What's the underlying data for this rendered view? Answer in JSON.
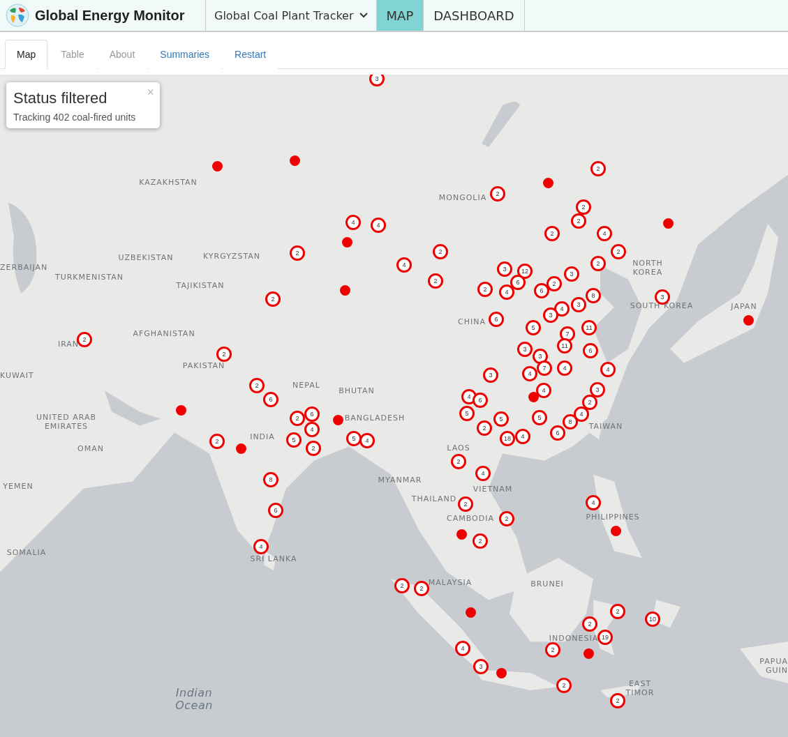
{
  "header": {
    "brand": "Global Energy Monitor",
    "tracker": "Global Coal Plant Tracker",
    "nav": [
      {
        "label": "MAP",
        "selected": true
      },
      {
        "label": "DASHBOARD",
        "selected": false
      }
    ]
  },
  "tabs": [
    {
      "label": "Map",
      "selected": true,
      "kind": "tab",
      "disabled": false
    },
    {
      "label": "Table",
      "selected": false,
      "kind": "tab",
      "disabled": true
    },
    {
      "label": "About",
      "selected": false,
      "kind": "tab",
      "disabled": true
    },
    {
      "label": "Summaries",
      "selected": false,
      "kind": "link",
      "disabled": false
    },
    {
      "label": "Restart",
      "selected": false,
      "kind": "link",
      "disabled": false
    }
  ],
  "info": {
    "title": "Status filtered",
    "text": "Tracking 402 coal-fired units",
    "close": "×"
  },
  "map": {
    "labels": [
      "KAZAKHSTAN",
      "MONGOLIA",
      "UZBEKISTAN",
      "KYRGYZSTAN",
      "ZERBAIJAN",
      "NORTH KOREA",
      "TURKMENISTAN",
      "TAJIKISTAN",
      "SOUTH KOREA",
      "JAPAN",
      "CHINA",
      "AFGHANISTAN",
      "IRAN",
      "PAKISTAN",
      "KUWAIT",
      "NEPAL",
      "BHUTAN",
      "UNITED ARAB EMIRATES",
      "BANGLADESH",
      "TAIWAN",
      "INDIA",
      "OMAN",
      "LAOS",
      "MYANMAR",
      "YEMEN",
      "VIETNAM",
      "THAILAND",
      "CAMBODIA",
      "PHILIPPINES",
      "SOMALIA",
      "SRI LANKA",
      "MALAYSIA",
      "BRUNEI",
      "INDONESIA",
      "PAPUA GUIN",
      "EAST TIMOR",
      "Indian Ocean"
    ],
    "markers": [
      {
        "kind": "cluster",
        "count": "3"
      },
      {
        "kind": "plant"
      },
      {
        "kind": "plant"
      },
      {
        "kind": "cluster",
        "count": "2"
      },
      {
        "kind": "plant"
      },
      {
        "kind": "cluster",
        "count": "2"
      },
      {
        "kind": "cluster",
        "count": "2"
      },
      {
        "kind": "cluster",
        "count": "4"
      },
      {
        "kind": "cluster",
        "count": "4"
      },
      {
        "kind": "cluster",
        "count": "2"
      },
      {
        "kind": "plant"
      },
      {
        "kind": "cluster",
        "count": "2"
      },
      {
        "kind": "cluster",
        "count": "4"
      },
      {
        "kind": "plant"
      },
      {
        "kind": "cluster",
        "count": "2"
      },
      {
        "kind": "cluster",
        "count": "2"
      },
      {
        "kind": "cluster",
        "count": "2"
      },
      {
        "kind": "cluster",
        "count": "4"
      },
      {
        "kind": "cluster",
        "count": "2"
      },
      {
        "kind": "cluster",
        "count": "3"
      },
      {
        "kind": "cluster",
        "count": "12"
      },
      {
        "kind": "cluster",
        "count": "3"
      },
      {
        "kind": "cluster",
        "count": "2"
      },
      {
        "kind": "cluster",
        "count": "6"
      },
      {
        "kind": "cluster",
        "count": "2"
      },
      {
        "kind": "plant"
      },
      {
        "kind": "cluster",
        "count": "2"
      },
      {
        "kind": "cluster",
        "count": "4"
      },
      {
        "kind": "cluster",
        "count": "6"
      },
      {
        "kind": "cluster",
        "count": "2"
      },
      {
        "kind": "cluster",
        "count": "8"
      },
      {
        "kind": "cluster",
        "count": "3"
      },
      {
        "kind": "cluster",
        "count": "3"
      },
      {
        "kind": "cluster",
        "count": "4"
      },
      {
        "kind": "cluster",
        "count": "3"
      },
      {
        "kind": "cluster",
        "count": "6"
      },
      {
        "kind": "plant"
      },
      {
        "kind": "cluster",
        "count": "5"
      },
      {
        "kind": "cluster",
        "count": "11"
      },
      {
        "kind": "cluster",
        "count": "7"
      },
      {
        "kind": "cluster",
        "count": "2"
      },
      {
        "kind": "cluster",
        "count": "11"
      },
      {
        "kind": "cluster",
        "count": "2"
      },
      {
        "kind": "cluster",
        "count": "3"
      },
      {
        "kind": "cluster",
        "count": "3"
      },
      {
        "kind": "cluster",
        "count": "6"
      },
      {
        "kind": "cluster",
        "count": "3"
      },
      {
        "kind": "cluster",
        "count": "4"
      },
      {
        "kind": "cluster",
        "count": "7"
      },
      {
        "kind": "cluster",
        "count": "4"
      },
      {
        "kind": "cluster",
        "count": "4"
      },
      {
        "kind": "cluster",
        "count": "2"
      },
      {
        "kind": "cluster",
        "count": "4"
      },
      {
        "kind": "cluster",
        "count": "3"
      },
      {
        "kind": "cluster",
        "count": "6"
      },
      {
        "kind": "cluster",
        "count": "4"
      },
      {
        "kind": "cluster",
        "count": "6"
      },
      {
        "kind": "plant"
      },
      {
        "kind": "cluster",
        "count": "2"
      },
      {
        "kind": "plant"
      },
      {
        "kind": "cluster",
        "count": "2"
      },
      {
        "kind": "cluster",
        "count": "6"
      },
      {
        "kind": "plant"
      },
      {
        "kind": "cluster",
        "count": "5"
      },
      {
        "kind": "cluster",
        "count": "5"
      },
      {
        "kind": "cluster",
        "count": "5"
      },
      {
        "kind": "cluster",
        "count": "8"
      },
      {
        "kind": "cluster",
        "count": "4"
      },
      {
        "kind": "cluster",
        "count": "4"
      },
      {
        "kind": "cluster",
        "count": "2"
      },
      {
        "kind": "cluster",
        "count": "2"
      },
      {
        "kind": "cluster",
        "count": "5"
      },
      {
        "kind": "cluster",
        "count": "5"
      },
      {
        "kind": "cluster",
        "count": "4"
      },
      {
        "kind": "cluster",
        "count": "18"
      },
      {
        "kind": "cluster",
        "count": "4"
      },
      {
        "kind": "cluster",
        "count": "6"
      },
      {
        "kind": "plant"
      },
      {
        "kind": "cluster",
        "count": "2"
      },
      {
        "kind": "cluster",
        "count": "2"
      },
      {
        "kind": "cluster",
        "count": "4"
      },
      {
        "kind": "cluster",
        "count": "8"
      },
      {
        "kind": "cluster",
        "count": "2"
      },
      {
        "kind": "cluster",
        "count": "4"
      },
      {
        "kind": "cluster",
        "count": "6"
      },
      {
        "kind": "cluster",
        "count": "2"
      },
      {
        "kind": "plant"
      },
      {
        "kind": "plant"
      },
      {
        "kind": "cluster",
        "count": "2"
      },
      {
        "kind": "cluster",
        "count": "4"
      },
      {
        "kind": "cluster",
        "count": "2"
      },
      {
        "kind": "cluster",
        "count": "2"
      },
      {
        "kind": "plant"
      },
      {
        "kind": "cluster",
        "count": "2"
      },
      {
        "kind": "cluster",
        "count": "10"
      },
      {
        "kind": "cluster",
        "count": "2"
      },
      {
        "kind": "cluster",
        "count": "19"
      },
      {
        "kind": "cluster",
        "count": "4"
      },
      {
        "kind": "cluster",
        "count": "2"
      },
      {
        "kind": "plant"
      },
      {
        "kind": "cluster",
        "count": "3"
      },
      {
        "kind": "plant"
      },
      {
        "kind": "cluster",
        "count": "2"
      },
      {
        "kind": "cluster",
        "count": "2"
      }
    ]
  }
}
